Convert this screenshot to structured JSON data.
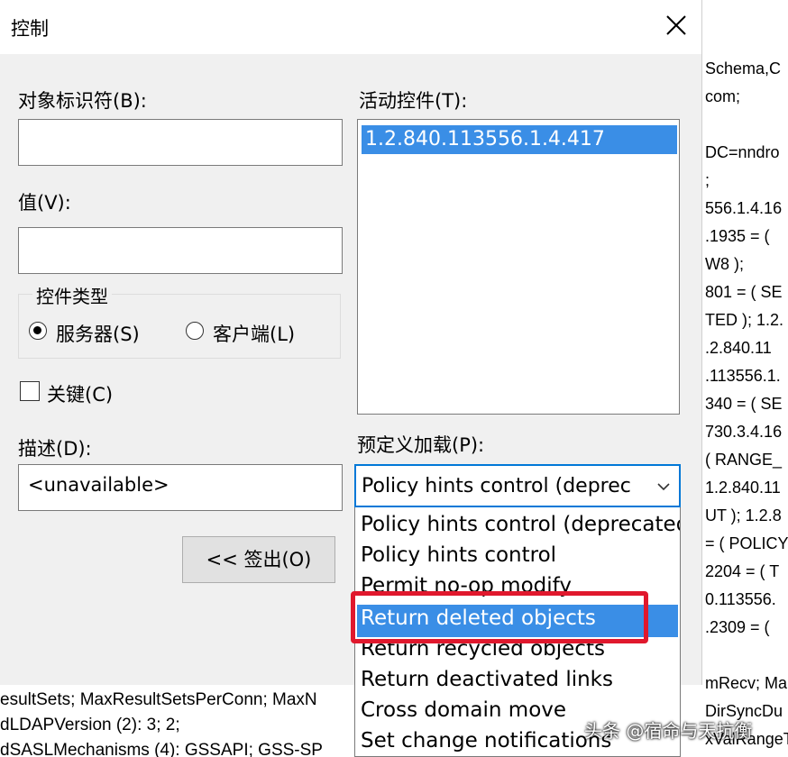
{
  "dialog": {
    "title": "控制",
    "object_id_label": "对象标识符(B):",
    "object_id_value": "",
    "value_label": "值(V):",
    "value_value": "",
    "control_type_legend": "控件类型",
    "radio_server_label": "服务器(S)",
    "radio_client_label": "客户端(L)",
    "critical_label": "关键(C)",
    "description_label": "描述(D):",
    "description_value": "<unavailable>",
    "active_controls_label": "活动控件(T):",
    "active_controls_items": [
      "1.2.840.113556.1.4.417"
    ],
    "predefined_label": "预定义加载(P):",
    "predefined_selected": "Policy hints control (deprec",
    "checkout_button": "<< 签出(O)"
  },
  "dropdown_options": [
    "Policy hints control (deprecated",
    "Policy hints control",
    "Permit no-op modify",
    "Return deleted objects",
    "Return recycled objects",
    "Return deactivated links",
    "Cross domain move",
    "Set change notifications"
  ],
  "background_right_lines": [
    "Schema,C",
    "com;",
    "",
    "DC=nndro",
    ";",
    "556.1.4.16",
    ".1935 = (",
    "W8 );",
    "801 = ( SE",
    "TED ); 1.2.",
    ".2.840.11",
    ".113556.1.",
    "340 = ( SE",
    "730.3.4.16",
    "( RANGE_",
    "1.2.840.11",
    "UT ); 1.2.8",
    "= ( POLICY",
    "2204 = ( T",
    "0.113556.",
    ".2309 = (",
    "",
    "mRecv; Ma",
    "DirSyncDu",
    "xValRangeTr"
  ],
  "background_bottom_lines": [
    "esultSets; MaxResultSetsPerConn; MaxN",
    "dLDAPVersion (2): 3; 2;",
    "dSASLMechanisms (4): GSSAPI; GSS-SP"
  ],
  "watermark": "头条 @宿命与天抗衡"
}
